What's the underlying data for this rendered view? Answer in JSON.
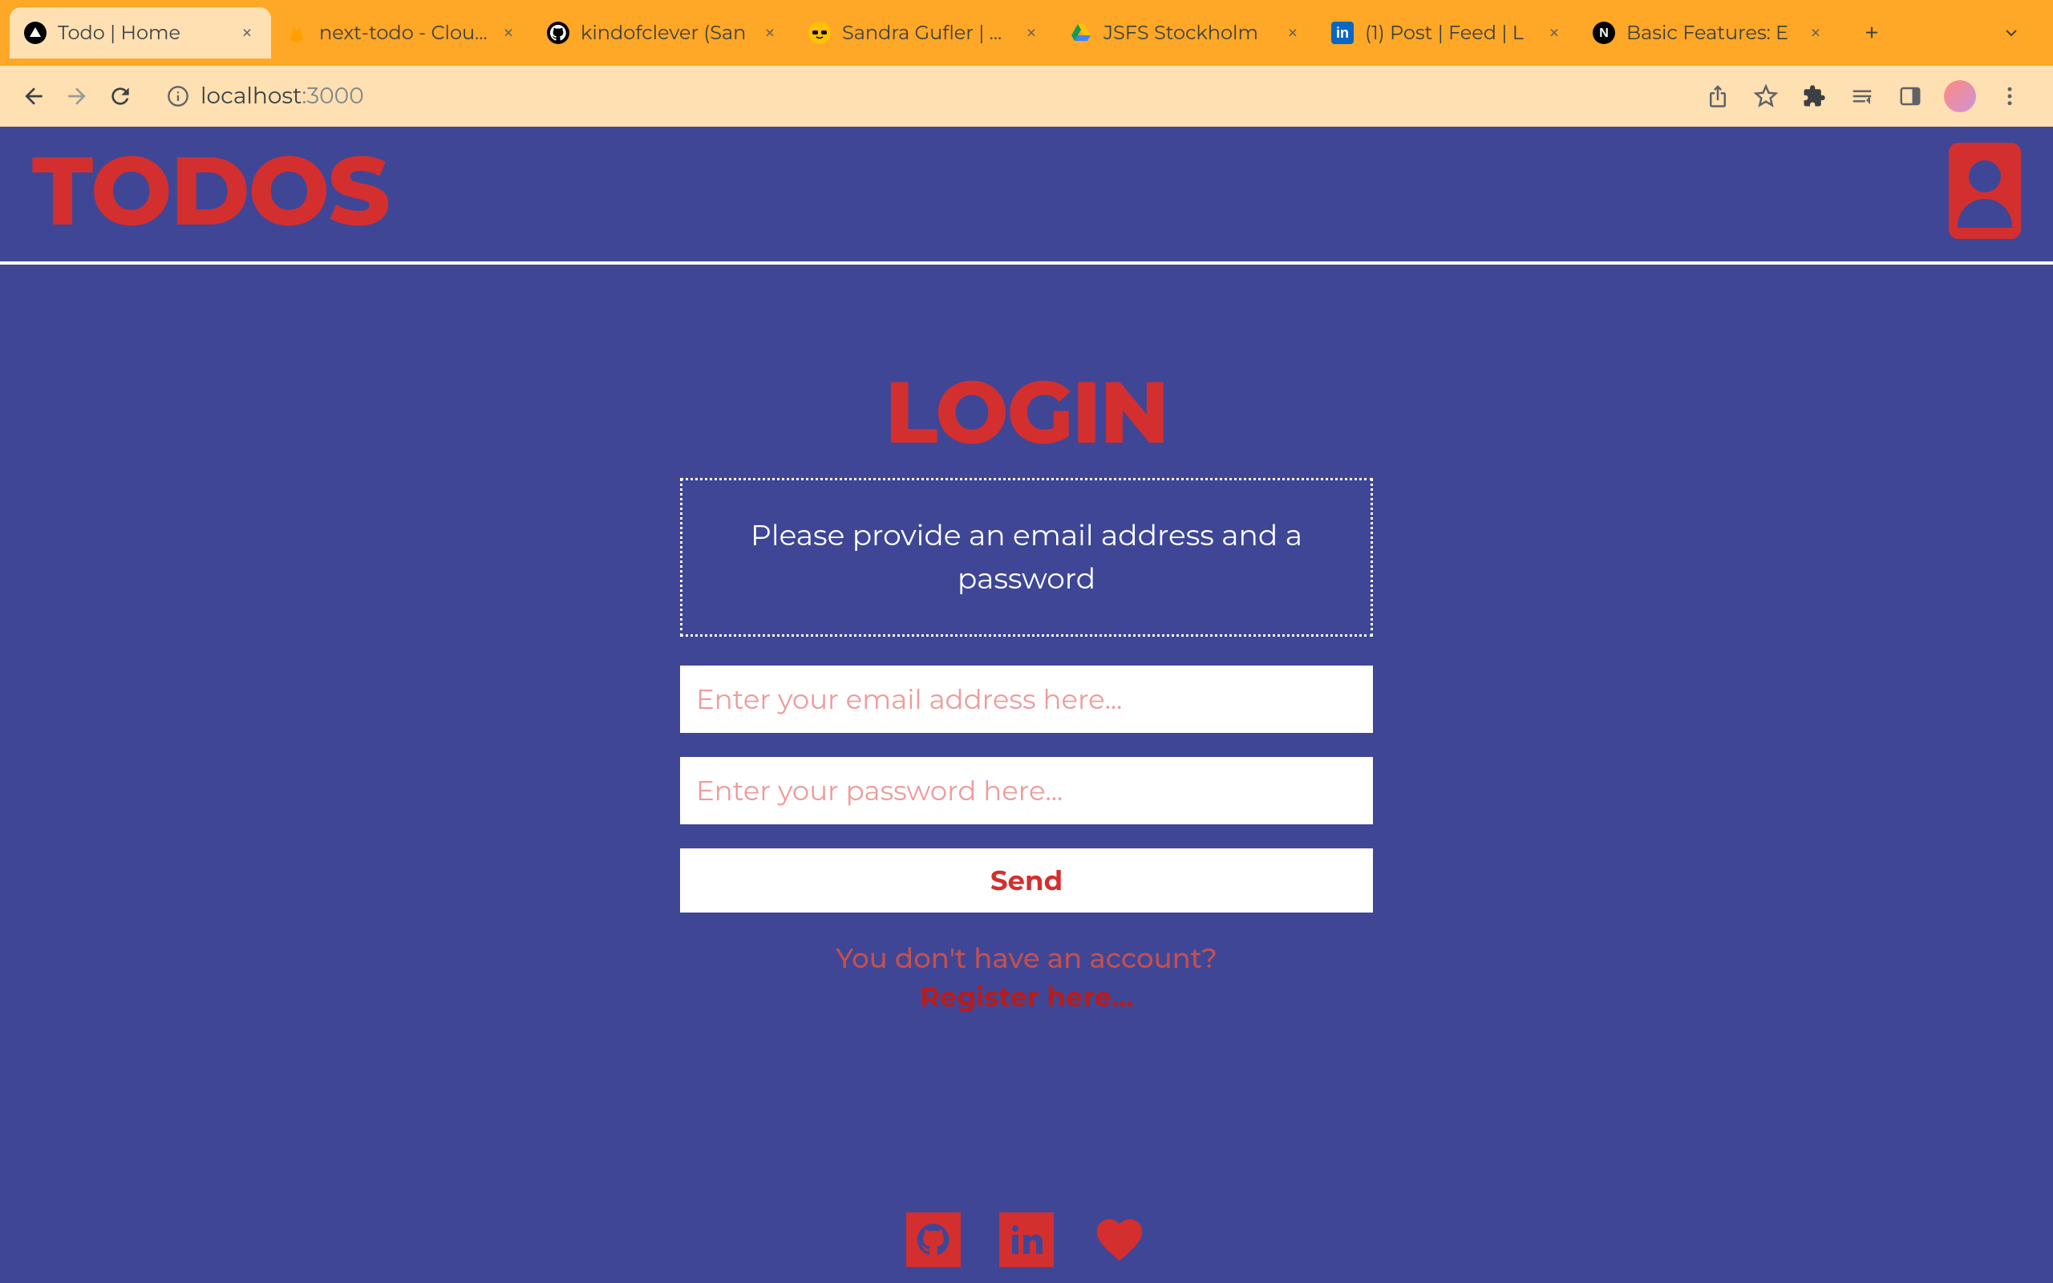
{
  "browser": {
    "tabs": [
      {
        "title": "Todo | Home",
        "favicon": "triangle"
      },
      {
        "title": "next-todo - Cloud",
        "favicon": "firebase"
      },
      {
        "title": "kindofclever (San",
        "favicon": "github"
      },
      {
        "title": "Sandra Gufler | Fu",
        "favicon": "sunglasses"
      },
      {
        "title": "JSFS Stockholm ",
        "favicon": "drive"
      },
      {
        "title": "(1) Post | Feed | L",
        "favicon": "linkedin"
      },
      {
        "title": "Basic Features: E",
        "favicon": "nextjs"
      }
    ],
    "url_host": "localhost",
    "url_path": ":3000"
  },
  "header": {
    "logo": "TODOS"
  },
  "login": {
    "title": "LOGIN",
    "instruction": "Please provide an email address and a password",
    "email_placeholder": "Enter your email address here...",
    "password_placeholder": "Enter your password here...",
    "send_label": "Send",
    "register_prompt": "You don't have an account?",
    "register_link": "Register here..."
  }
}
